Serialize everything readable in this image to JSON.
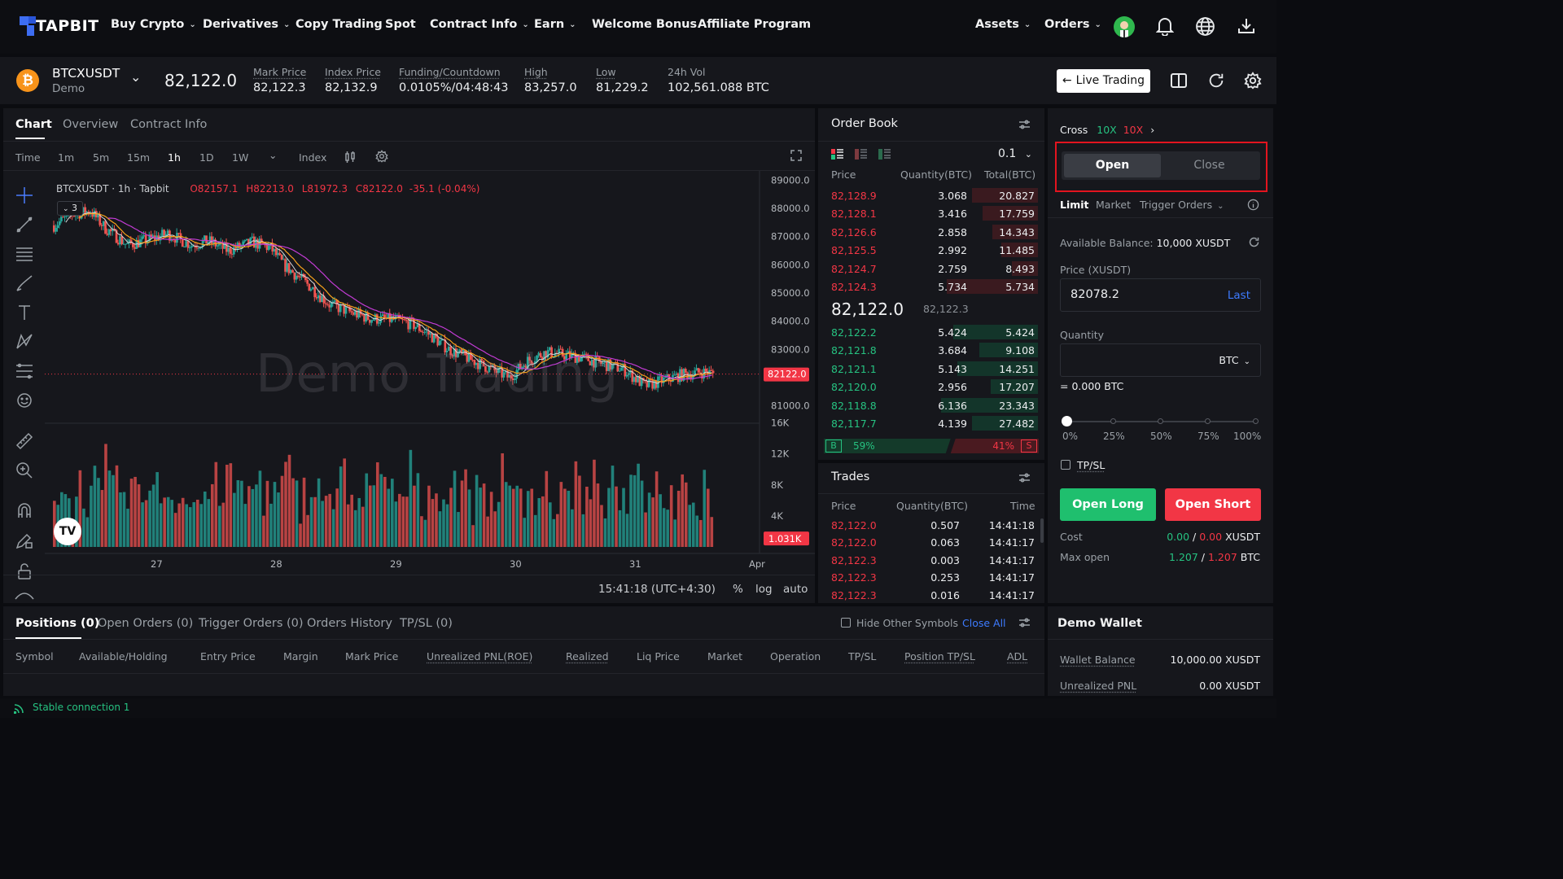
{
  "nav": {
    "logo": "TAPBIT",
    "items": [
      "Buy Crypto",
      "Derivatives",
      "Copy Trading",
      "Spot",
      "Contract Info",
      "Earn",
      "Welcome Bonus",
      "Affiliate Program"
    ],
    "assets": "Assets",
    "orders": "Orders"
  },
  "ticker": {
    "symbol": "BTCXUSDT",
    "mode": "Demo",
    "last_price": "82,122.0",
    "stats": [
      {
        "label": "Mark Price",
        "value": "82,122.3"
      },
      {
        "label": "Index Price",
        "value": "82,132.9"
      },
      {
        "label": "Funding/Countdown",
        "value": "0.0105%/04:48:43"
      },
      {
        "label": "High",
        "value": "83,257.0"
      },
      {
        "label": "Low",
        "value": "81,229.2"
      },
      {
        "label": "24h Vol",
        "value": "102,561.088 BTC"
      }
    ],
    "live_trading": "Live Trading"
  },
  "chart_panel": {
    "tabs": [
      "Chart",
      "Overview",
      "Contract Info"
    ],
    "intervals": [
      "Time",
      "1m",
      "5m",
      "15m",
      "1h",
      "1D",
      "1W"
    ],
    "index_label": "Index",
    "legend_symbol": "BTCXUSDT · 1h · Tapbit",
    "ohlc": {
      "o": "O82157.1",
      "h": "H82213.0",
      "l": "L81972.3",
      "c": "C82122.0",
      "chg": "-35.1 (-0.04%)"
    },
    "indicator_count": "3",
    "watermark": "Demo Trading",
    "time_readout": "15:41:18 (UTC+4:30)",
    "scale_options": [
      "%",
      "log",
      "auto"
    ]
  },
  "chart_data": {
    "type": "candlestick",
    "price_axis": [
      "89000.0",
      "88000.0",
      "87000.0",
      "86000.0",
      "85000.0",
      "84000.0",
      "83000.0",
      "82122.0",
      "81000.0"
    ],
    "price_ylim": [
      80900,
      89100
    ],
    "current_price_label": "82122.0",
    "volume_axis": [
      "16K",
      "12K",
      "8K",
      "4K"
    ],
    "current_volume_label": "1.031K",
    "x_ticks": [
      "27",
      "28",
      "29",
      "30",
      "31",
      "Apr"
    ]
  },
  "orderbook": {
    "title": "Order Book",
    "precision": "0.1",
    "headers": [
      "Price",
      "Quantity(BTC)",
      "Total(BTC)"
    ],
    "asks": [
      {
        "price": "82,128.9",
        "qty": "3.068",
        "total": "20.827",
        "depth": 0.45
      },
      {
        "price": "82,128.1",
        "qty": "3.416",
        "total": "17.759",
        "depth": 0.38
      },
      {
        "price": "82,126.6",
        "qty": "2.858",
        "total": "14.343",
        "depth": 0.31
      },
      {
        "price": "82,125.5",
        "qty": "2.992",
        "total": "11.485",
        "depth": 0.25
      },
      {
        "price": "82,124.7",
        "qty": "2.759",
        "total": "8.493",
        "depth": 0.18
      },
      {
        "price": "82,124.3",
        "qty": "5.734",
        "total": "5.734",
        "depth": 0.62
      }
    ],
    "mid_price": "82,122.0",
    "mid_mark": "82,122.3",
    "bids": [
      {
        "price": "82,122.2",
        "qty": "5.424",
        "total": "5.424",
        "depth": 0.58
      },
      {
        "price": "82,121.8",
        "qty": "3.684",
        "total": "9.108",
        "depth": 0.4
      },
      {
        "price": "82,121.1",
        "qty": "5.143",
        "total": "14.251",
        "depth": 0.55
      },
      {
        "price": "82,120.0",
        "qty": "2.956",
        "total": "17.207",
        "depth": 0.32
      },
      {
        "price": "82,118.8",
        "qty": "6.136",
        "total": "23.343",
        "depth": 0.66
      },
      {
        "price": "82,117.7",
        "qty": "4.139",
        "total": "27.482",
        "depth": 0.45
      }
    ],
    "buy_label": "B",
    "sell_label": "S",
    "buy_pct": "59%",
    "sell_pct": "41%"
  },
  "trades": {
    "title": "Trades",
    "headers": [
      "Price",
      "Quantity(BTC)",
      "Time"
    ],
    "rows": [
      {
        "price": "82,122.0",
        "qty": "0.507",
        "time": "14:41:18"
      },
      {
        "price": "82,122.0",
        "qty": "0.063",
        "time": "14:41:17"
      },
      {
        "price": "82,122.3",
        "qty": "0.003",
        "time": "14:41:17"
      },
      {
        "price": "82,122.3",
        "qty": "0.253",
        "time": "14:41:17"
      },
      {
        "price": "82,122.3",
        "qty": "0.016",
        "time": "14:41:17"
      }
    ]
  },
  "order_form": {
    "margin_mode": "Cross",
    "lev_long": "10X",
    "lev_short": "10X",
    "open": "Open",
    "close": "Close",
    "types": [
      "Limit",
      "Market",
      "Trigger Orders"
    ],
    "available_label": "Available Balance:",
    "available_value": "10,000 XUSDT",
    "price_label": "Price (XUSDT)",
    "price_value": "82078.2",
    "last": "Last",
    "quantity_label": "Quantity",
    "quantity_unit": "BTC",
    "equiv": "= 0.000 BTC",
    "slider_marks": [
      "0%",
      "25%",
      "50%",
      "75%",
      "100%"
    ],
    "slider_value": 0,
    "tpsl": "TP/SL",
    "open_long": "Open Long",
    "open_short": "Open Short",
    "cost_label": "Cost",
    "cost_long": "0.00",
    "cost_short": "0.00",
    "cost_unit": "XUSDT",
    "maxopen_label": "Max open",
    "max_long": "1.207",
    "max_short": "1.207",
    "max_unit": "BTC"
  },
  "positions": {
    "tabs": [
      "Positions (0)",
      "Open Orders (0)",
      "Trigger Orders (0)",
      "Orders History",
      "TP/SL (0)"
    ],
    "hide_other": "Hide Other Symbols",
    "close_all": "Close All",
    "columns": [
      "Symbol",
      "Available/Holding",
      "Entry Price",
      "Margin",
      "Mark Price",
      "Unrealized PNL(ROE)",
      "Realized",
      "Liq Price",
      "Market",
      "Operation",
      "TP/SL",
      "Position TP/SL",
      "ADL"
    ]
  },
  "wallet": {
    "title": "Demo Wallet",
    "balance_label": "Wallet Balance",
    "balance_value": "10,000.00 XUSDT",
    "upnl_label": "Unrealized PNL",
    "upnl_value": "0.00 XUSDT"
  },
  "status": {
    "connection": "Stable connection 1"
  },
  "colors": {
    "up": "#26a69a",
    "down": "#ef5350",
    "accent_red": "#f23645",
    "accent_green": "#26c281",
    "link_blue": "#3d7bff"
  }
}
